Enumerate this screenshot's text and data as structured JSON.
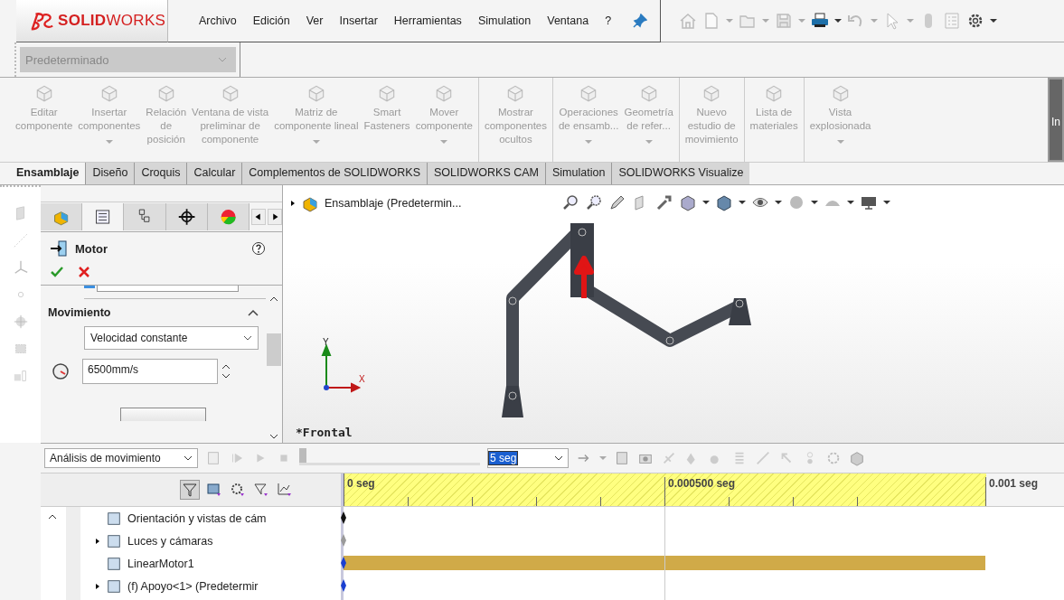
{
  "logo": "**SOLID**WORKS",
  "menu": [
    "Archivo",
    "Edición",
    "Ver",
    "Insertar",
    "Herramientas",
    "Simulation",
    "Ventana",
    "?"
  ],
  "configuration": {
    "value": "Predeterminado"
  },
  "ribbon": [
    {
      "label": "Editar\ncomponente",
      "dropdown": false,
      "group_start": false
    },
    {
      "label": "Insertar\ncomponentes",
      "dropdown": true,
      "group_start": false
    },
    {
      "label": "Relación\nde\nposición",
      "dropdown": false,
      "group_start": false
    },
    {
      "label": "Ventana de vista\npreliminar de\ncomponente",
      "dropdown": false,
      "group_start": false
    },
    {
      "label": "Matriz de\ncomponente lineal",
      "dropdown": true,
      "group_start": false
    },
    {
      "label": "Smart\nFasteners",
      "dropdown": false,
      "group_start": false
    },
    {
      "label": "Mover\ncomponente",
      "dropdown": true,
      "group_start": false
    },
    {
      "label": "Mostrar\ncomponentes\nocultos",
      "dropdown": false,
      "group_start": true
    },
    {
      "label": "Operaciones\nde ensamb...",
      "dropdown": true,
      "group_start": true
    },
    {
      "label": "Geometría\nde refer...",
      "dropdown": true,
      "group_start": false
    },
    {
      "label": "Nuevo\nestudio de\nmovimiento",
      "dropdown": false,
      "group_start": true
    },
    {
      "label": "Lista de\nmateriales",
      "dropdown": false,
      "group_start": true
    },
    {
      "label": "Vista\nexplosionada",
      "dropdown": true,
      "group_start": true
    }
  ],
  "ribbon_overflow": "In",
  "tabs": [
    {
      "label": "Ensamblaje",
      "selected": true
    },
    {
      "label": "Diseño",
      "selected": false
    },
    {
      "label": "Croquis",
      "selected": false
    },
    {
      "label": "Calcular",
      "selected": false
    },
    {
      "label": "Complementos de SOLIDWORKS",
      "selected": false
    },
    {
      "label": "SOLIDWORKS CAM",
      "selected": false
    },
    {
      "label": "Simulation",
      "selected": false
    },
    {
      "label": "SOLIDWORKS Visualize",
      "selected": false
    }
  ],
  "panel": {
    "title": "Motor",
    "section": "Movimiento",
    "motion_type": "Velocidad constante",
    "speed": "6500mm/s"
  },
  "viewport": {
    "tree_item": "Ensamblaje  (Predetermin...",
    "view_name": "*Frontal",
    "axis_x": "X",
    "axis_y": "Y"
  },
  "timeline": {
    "study": "Análisis de movimiento",
    "playback": {
      "level": 0
    },
    "duration": "5 seg",
    "ticks": [
      "0 seg",
      "0.000500 seg",
      "0.001 seg"
    ],
    "rows": [
      {
        "label": "Orientación y vistas de cám",
        "expandable": false,
        "color": "#111111",
        "bar": false
      },
      {
        "label": "Luces y cámaras",
        "expandable": true,
        "color": "#9a9a9a",
        "bar": false
      },
      {
        "label": "LinearMotor1",
        "expandable": false,
        "color": "#1a3fd0",
        "bar": true
      },
      {
        "label": "(f) Apoyo<1> (Predetermir",
        "expandable": true,
        "color": "#1a3fd0",
        "bar": false
      }
    ]
  }
}
